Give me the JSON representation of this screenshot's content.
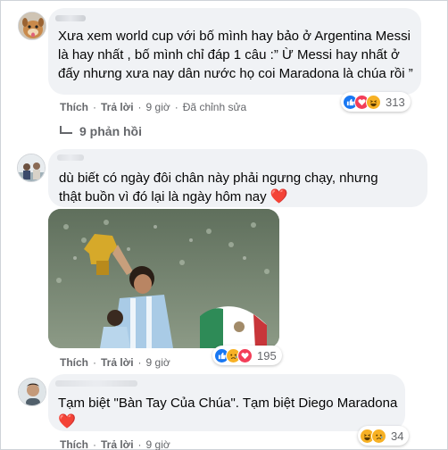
{
  "comments": [
    {
      "text": "Xưa xem world cup với bố mình hay bảo ở Argentina Messi là hay nhất , bố mình chỉ đáp 1 câu :” Ừ Messi hay nhất ở đấy nhưng xưa nay dân nước họ coi Maradona là chúa rồi ”",
      "actions": {
        "like": "Thích",
        "reply": "Trả lời",
        "time": "9 giờ",
        "edited": "Đã chỉnh sửa"
      },
      "reaction_icons": [
        "like-icon",
        "love-icon",
        "haha-icon"
      ],
      "reaction_count": "313",
      "replies_label": "9 phản hồi"
    },
    {
      "text_line1": "dù biết có ngày đôi chân này phải ngưng chạy, nhưng",
      "text_line2": "thật buồn vì đó lại là ngày hôm nay",
      "emoji": "❤️",
      "actions": {
        "like": "Thích",
        "reply": "Trả lời",
        "time": "9 giờ"
      },
      "reaction_icons": [
        "like-icon",
        "sad-icon",
        "love-icon"
      ],
      "reaction_count": "195"
    },
    {
      "text": "Tạm biệt \"Bàn Tay Của Chúa\". Tạm biệt Diego Maradona",
      "emoji": "❤️",
      "actions": {
        "like": "Thích",
        "reply": "Trả lời",
        "time": "9 giờ"
      },
      "reaction_icons": [
        "haha-icon",
        "sad-icon"
      ],
      "reaction_count": "34"
    }
  ],
  "colors": {
    "bubble": "#f0f2f5",
    "meta_text": "#65676b",
    "like_blue": "#1877f2",
    "love_red": "#f33e58",
    "emoji_yellow": "#f7b125"
  }
}
